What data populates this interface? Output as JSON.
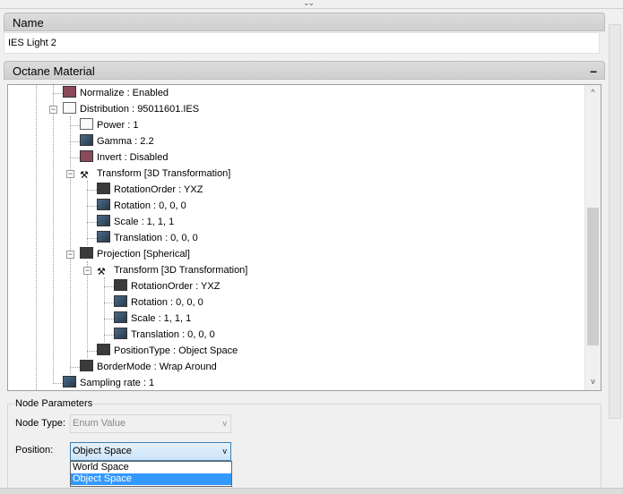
{
  "name_panel": {
    "title": "Name",
    "value": "IES Light 2"
  },
  "material_panel": {
    "title": "Octane Material",
    "collapse_glyph": "–"
  },
  "tree_rows": [
    "Normalize : Enabled",
    "Distribution : 95011601.IES",
    "Power : 1",
    "Gamma : 2.2",
    "Invert : Disabled",
    "Transform  [3D Transformation]",
    "RotationOrder : YXZ",
    "Rotation : 0, 0, 0",
    "Scale : 1, 1, 1",
    "Translation : 0, 0, 0",
    "Projection  [Spherical]",
    "Transform  [3D Transformation]",
    "RotationOrder : YXZ",
    "Rotation : 0, 0, 0",
    "Scale : 1, 1, 1",
    "Translation : 0, 0, 0",
    "PositionType : Object Space",
    "BorderMode : Wrap Around",
    "Sampling rate : 1"
  ],
  "node_params": {
    "title": "Node Parameters",
    "node_type_label": "Node Type:",
    "node_type_value": "Enum Value",
    "position_label": "Position:",
    "position_value": "Object Space",
    "options": [
      "World Space",
      "Object Space"
    ],
    "selected_option": "Object Space"
  }
}
